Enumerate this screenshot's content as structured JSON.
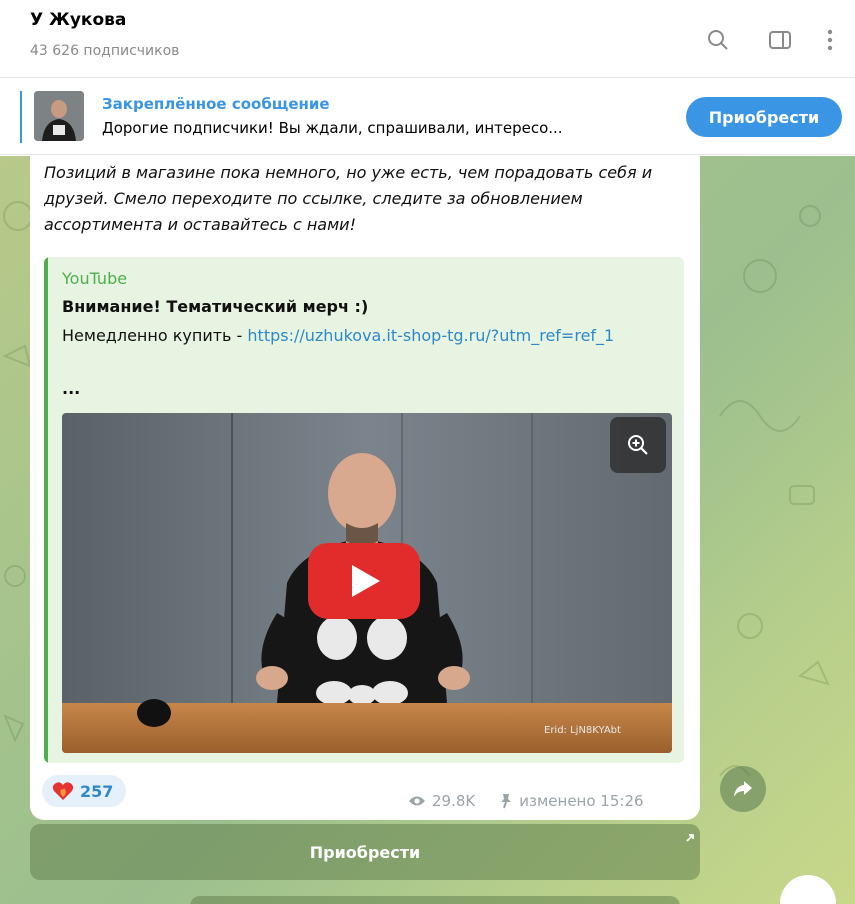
{
  "header": {
    "title": "У Жукова",
    "subscribers": "43 626 подписчиков",
    "icons": [
      "search-icon",
      "sidebar-toggle-icon",
      "more-vertical-icon"
    ]
  },
  "pinned": {
    "label": "Закреплённое сообщение",
    "text": "Дорогие подписчики! Вы ждали, спрашивали, интересо...",
    "button": "Приобрести"
  },
  "message": {
    "italic_text": "Позиций в магазине пока немного, но уже есть, чем порадовать себя и друзей. Смело переходите по ссылке, следите за обновлением ассортимента и оставайтесь с нами!",
    "preview": {
      "site": "YouTube",
      "title": "Внимание! Тематический мерч :)",
      "desc_prefix": "Немедленно купить - ",
      "link": "https://uzhukova.it-shop-tg.ru/?utm_ref=ref_1",
      "ellipsis": "...",
      "erid": "Erid: LjN8KYAbt"
    },
    "reaction": {
      "emoji": "heart-fire",
      "count": "257"
    },
    "views": "29.8K",
    "edited": "изменено 15:26"
  },
  "inline_button": {
    "label": "Приобрести"
  },
  "colors": {
    "accent": "#3a95e4",
    "link": "#2e88c9",
    "youtube_green": "#4fae4e"
  }
}
